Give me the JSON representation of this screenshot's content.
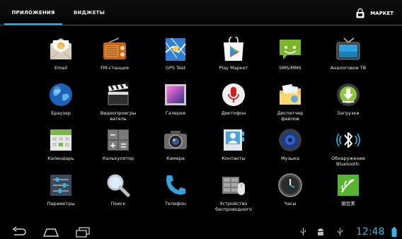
{
  "tabs": {
    "apps": "ПРИЛОЖЕНИЯ",
    "widgets": "ВИДЖЕТЫ"
  },
  "store": {
    "label": "МАРКЕТ"
  },
  "apps": [
    {
      "label": "Email",
      "icon": "email-icon"
    },
    {
      "label": "FM-станция",
      "icon": "radio-icon"
    },
    {
      "label": "GPS Test",
      "icon": "gps-map-icon"
    },
    {
      "label": "Play Маркет",
      "icon": "play-store-icon"
    },
    {
      "label": "SMS/MMS",
      "icon": "sms-icon"
    },
    {
      "label": "Аналоговое ТВ",
      "icon": "tv-icon"
    },
    {
      "label": "Браузер",
      "icon": "globe-icon"
    },
    {
      "label": "Видеопроигрыватель",
      "line1": "Видеопроигры",
      "line2": "ватель",
      "icon": "clapperboard-icon"
    },
    {
      "label": "Галерея",
      "icon": "gallery-icon"
    },
    {
      "label": "Диктофон",
      "icon": "microphone-icon"
    },
    {
      "label": "Диспетчер файлов",
      "line1": "Диспетчер",
      "line2": "файлов",
      "icon": "file-manager-icon"
    },
    {
      "label": "Загрузки",
      "icon": "download-icon"
    },
    {
      "label": "Календарь",
      "icon": "calendar-icon"
    },
    {
      "label": "Калькулятор",
      "icon": "calculator-icon"
    },
    {
      "label": "Камера",
      "icon": "camera-icon"
    },
    {
      "label": "Контакты",
      "icon": "contacts-icon"
    },
    {
      "label": "Музыка",
      "icon": "speaker-icon"
    },
    {
      "label": "Обнаружение Bluetooth-",
      "line1": "Обнаружение",
      "line2": "Bluetooth-",
      "icon": "bluetooth-icon"
    },
    {
      "label": "Параметры",
      "icon": "settings-sliders-icon"
    },
    {
      "label": "Поиск",
      "icon": "magnifier-icon"
    },
    {
      "label": "Телефон",
      "icon": "phone-icon"
    },
    {
      "label": "Устройство беспроводного",
      "line1": "Устройство",
      "line2": "беспроводного",
      "icon": "wireless-device-icon"
    },
    {
      "label": "Часы",
      "icon": "clock-icon"
    },
    {
      "label": "豌豆荚",
      "icon": "wandoujia-icon"
    }
  ],
  "status": {
    "time": "12:48"
  },
  "colors": {
    "accent": "#33b5e5",
    "background": "#000000"
  }
}
